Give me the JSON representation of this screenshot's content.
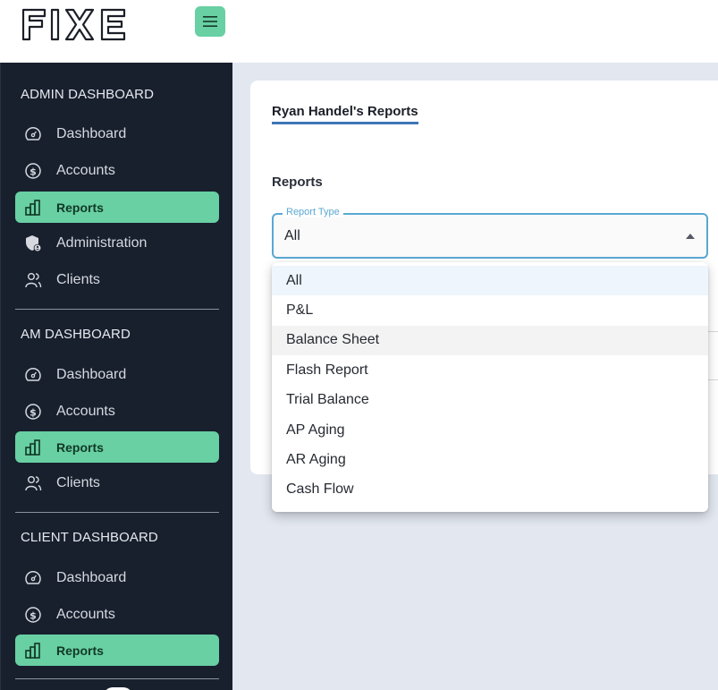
{
  "header": {
    "logo_text": "FIXE",
    "menu_toggle_icon": "hamburger-icon"
  },
  "colors": {
    "accent_green": "#68d0a3",
    "sidebar_bg": "#18202e",
    "focus_blue": "#5aa8d3",
    "title_underline": "#3f75b8",
    "main_bg": "#e2e7f0"
  },
  "sidebar": {
    "sections": [
      {
        "title": "ADMIN DASHBOARD",
        "items": [
          {
            "label": "Dashboard",
            "icon": "speedometer-icon",
            "active": false
          },
          {
            "label": "Accounts",
            "icon": "dollar-circle-icon",
            "active": false
          },
          {
            "label": "Reports",
            "icon": "bar-chart-icon",
            "active": true
          },
          {
            "label": "Administration",
            "icon": "shield-user-icon",
            "active": false
          },
          {
            "label": "Clients",
            "icon": "users-icon",
            "active": false
          }
        ]
      },
      {
        "title": "AM DASHBOARD",
        "items": [
          {
            "label": "Dashboard",
            "icon": "speedometer-icon",
            "active": false
          },
          {
            "label": "Accounts",
            "icon": "dollar-circle-icon",
            "active": false
          },
          {
            "label": "Reports",
            "icon": "bar-chart-icon",
            "active": true
          },
          {
            "label": "Clients",
            "icon": "users-icon",
            "active": false
          }
        ]
      },
      {
        "title": "CLIENT DASHBOARD",
        "items": [
          {
            "label": "Dashboard",
            "icon": "speedometer-icon",
            "active": false
          },
          {
            "label": "Accounts",
            "icon": "dollar-circle-icon",
            "active": false
          },
          {
            "label": "Reports",
            "icon": "bar-chart-icon",
            "active": true
          }
        ]
      }
    ]
  },
  "main": {
    "page_title": "Ryan Handel's Reports",
    "section_label": "Reports",
    "report_type": {
      "label": "Report Type",
      "value": "All",
      "options": [
        "All",
        "P&L",
        "Balance Sheet",
        "Flash Report",
        "Trial Balance",
        "AP Aging",
        "AR Aging",
        "Cash Flow"
      ],
      "selected_index": 0,
      "hovered_index": 2
    }
  }
}
